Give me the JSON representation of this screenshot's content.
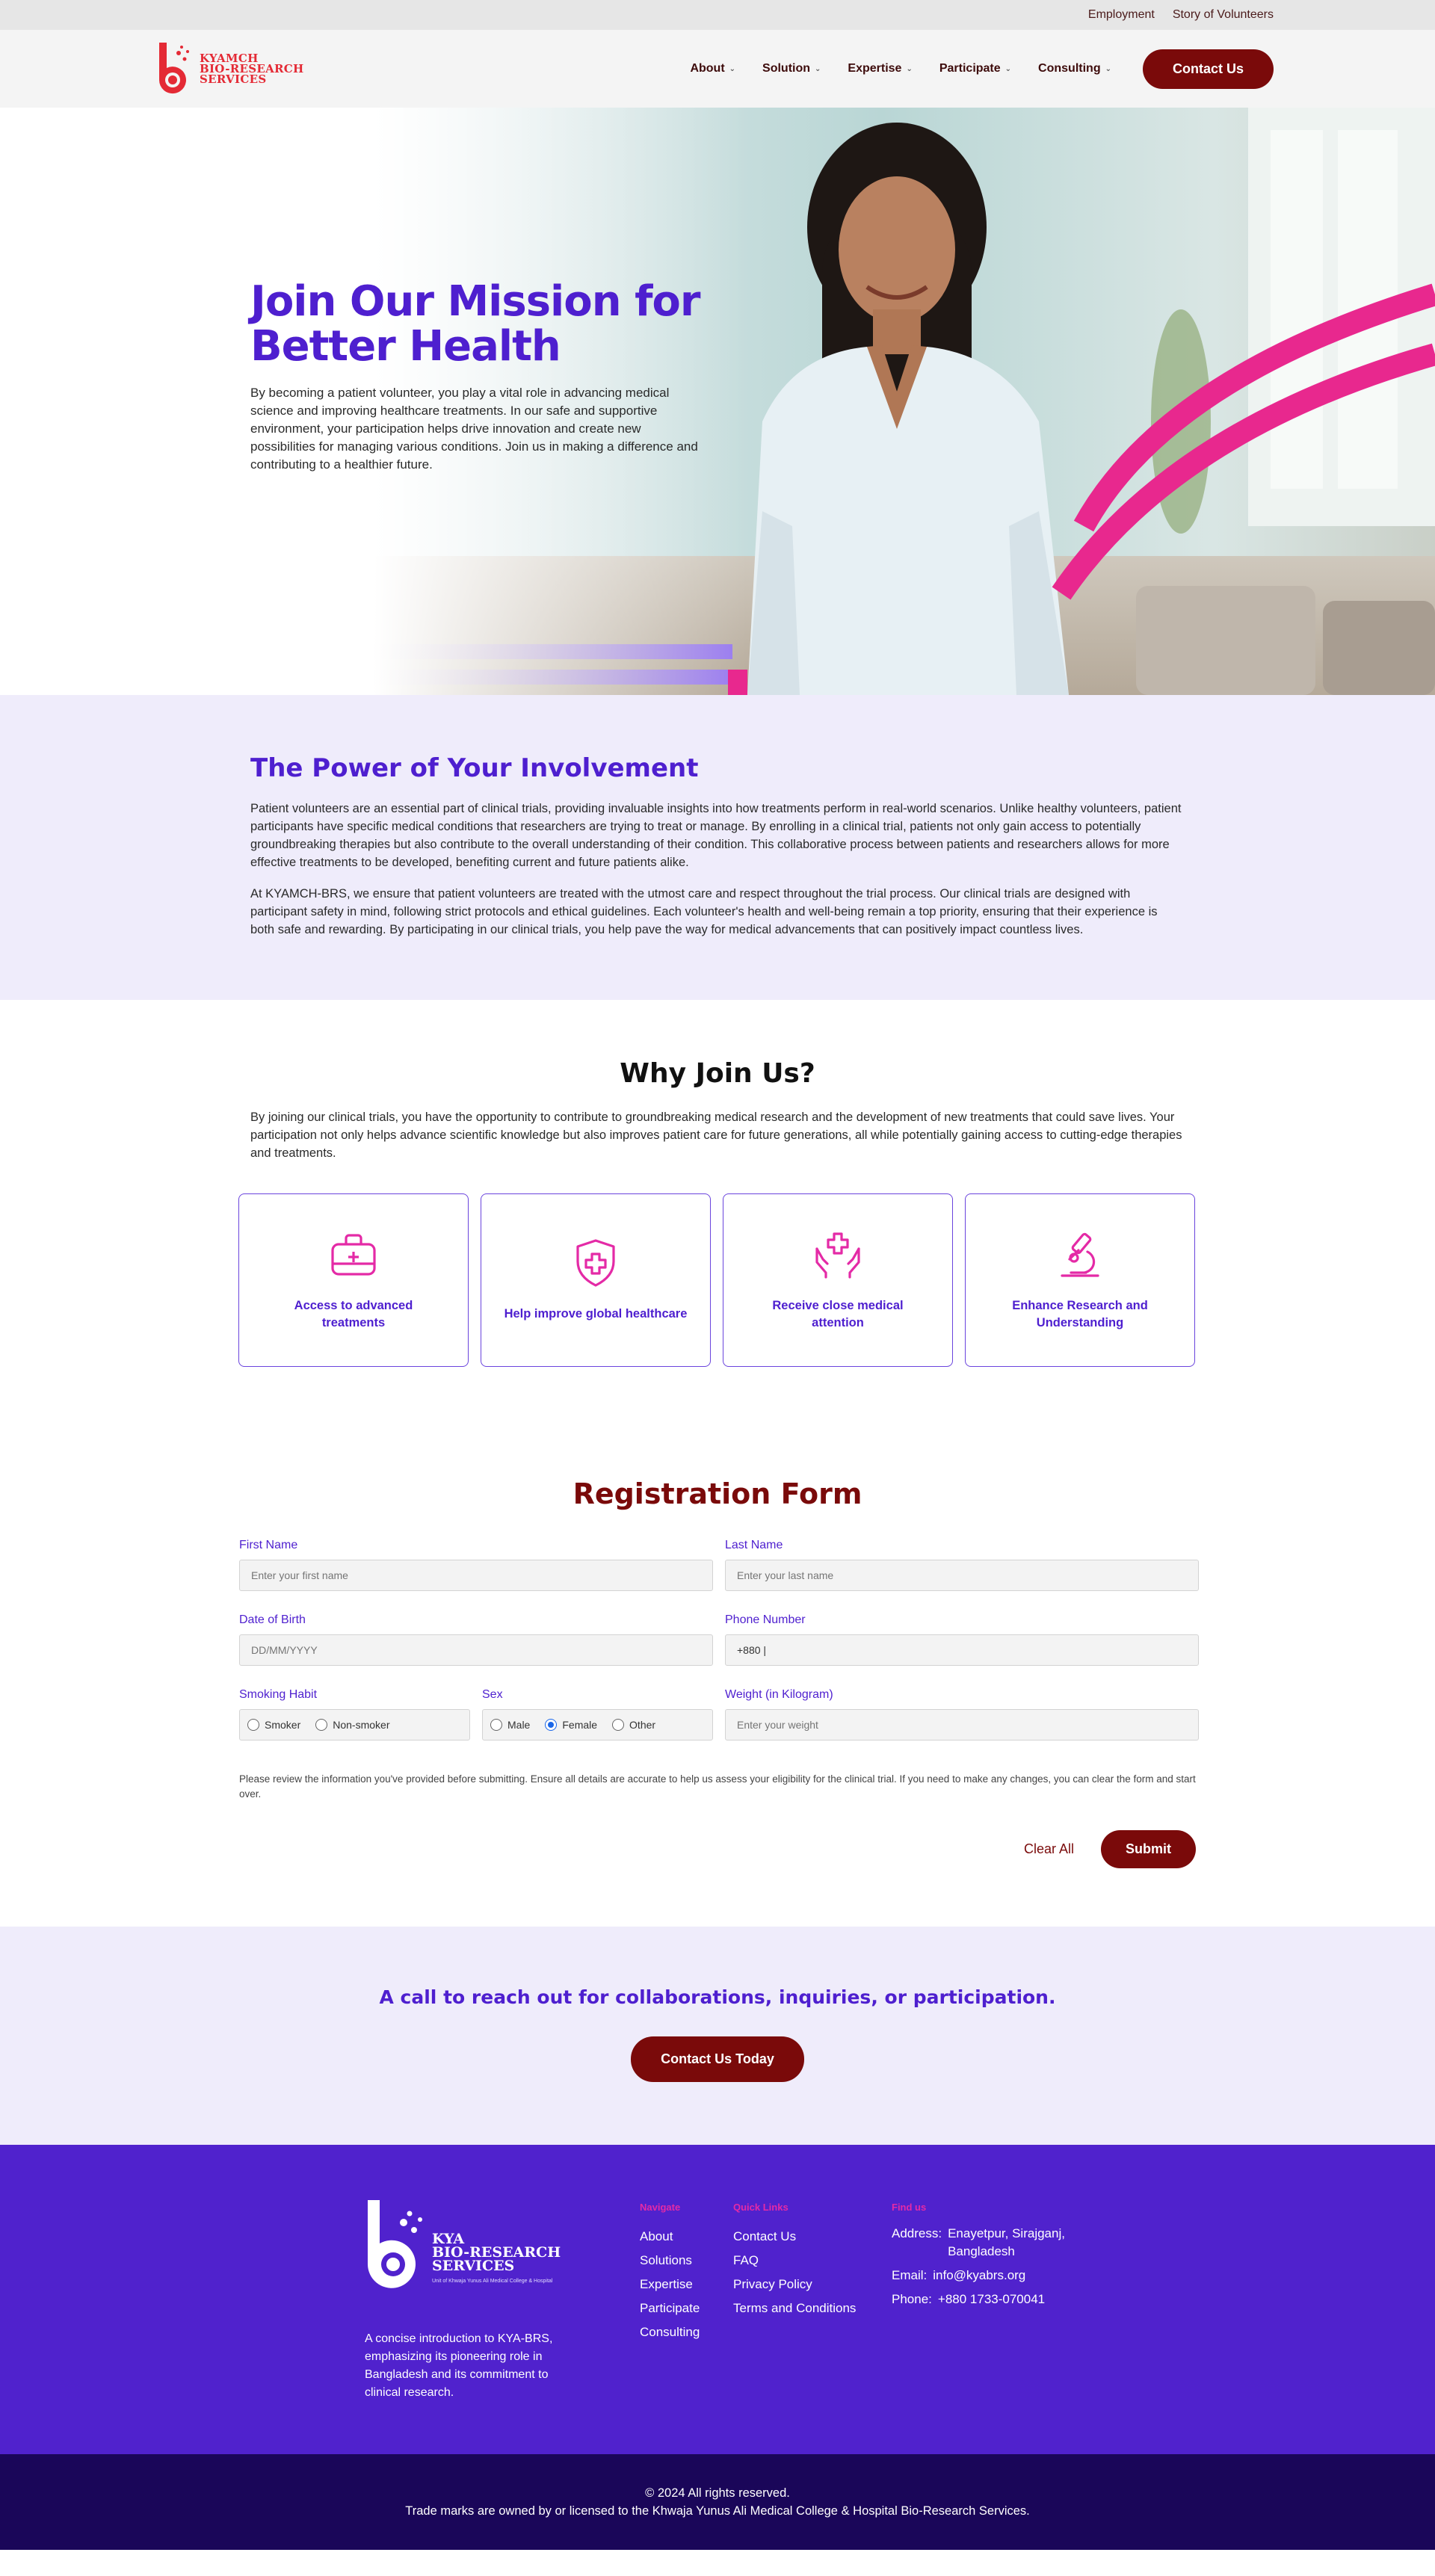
{
  "topbar": {
    "links": [
      "Employment",
      "Story of Volunteers"
    ]
  },
  "header": {
    "logo_lines": [
      "KYAMCH",
      "BIO-RESEARCH",
      "SERVICES"
    ],
    "nav": [
      "About",
      "Solution",
      "Expertise",
      "Participate",
      "Consulting"
    ],
    "contact_label": "Contact Us"
  },
  "hero": {
    "title_line1": "Join Our Mission for",
    "title_line2": "Better Health",
    "text": "By becoming a patient volunteer, you play a vital role in advancing medical science and improving healthcare treatments. In our safe and supportive environment, your participation helps drive innovation and create new possibilities for managing various conditions. Join us in making a difference and contributing to a healthier future."
  },
  "involvement": {
    "title": "The Power of Your Involvement",
    "p1": "Patient volunteers are an essential part of clinical trials, providing invaluable insights into how treatments perform in real-world scenarios. Unlike healthy volunteers, patient participants have specific medical conditions that researchers are trying to treat or manage. By enrolling in a clinical trial, patients not only gain access to potentially groundbreaking therapies but also contribute to the overall understanding of their condition. This collaborative process between patients and researchers allows for more effective treatments to be developed, benefiting current and future patients alike.",
    "p2": "At KYAMCH-BRS, we ensure that patient volunteers are treated with the utmost care and respect throughout the trial process. Our clinical trials are designed with participant safety in mind, following strict protocols and ethical guidelines. Each volunteer's health and well-being remain a top priority, ensuring that their experience is both safe and rewarding. By participating in our clinical trials, you help pave the way for medical advancements that can positively impact countless lives."
  },
  "why": {
    "title": "Why Join Us?",
    "intro": "By joining our clinical trials, you have the opportunity to contribute to groundbreaking medical research and the development of new treatments that could save lives. Your participation not only helps advance scientific knowledge but also improves patient care for future generations, all while potentially gaining access to cutting-edge therapies and treatments.",
    "cards": [
      {
        "icon": "medical-kit-icon",
        "label": "Access to advanced treatments"
      },
      {
        "icon": "shield-plus-icon",
        "label": "Help improve global healthcare"
      },
      {
        "icon": "hands-cross-icon",
        "label": "Receive close medical attention"
      },
      {
        "icon": "microscope-icon",
        "label": "Enhance Research and Understanding"
      }
    ]
  },
  "registration": {
    "title": "Registration Form",
    "first_name": {
      "label": "First Name",
      "placeholder": "Enter your first name"
    },
    "last_name": {
      "label": "Last Name",
      "placeholder": "Enter your last name"
    },
    "dob": {
      "label": "Date of Birth",
      "placeholder": "DD/MM/YYYY"
    },
    "phone": {
      "label": "Phone Number",
      "value": "+880 |"
    },
    "smoking": {
      "label": "Smoking Habit",
      "options": [
        "Smoker",
        "Non-smoker"
      ]
    },
    "sex": {
      "label": "Sex",
      "options": [
        "Male",
        "Female",
        "Other"
      ],
      "selected": "Female"
    },
    "weight": {
      "label": "Weight (in Kilogram)",
      "placeholder": "Enter your weight"
    },
    "note": "Please review the information you've provided before submitting. Ensure all details are accurate to help us assess your eligibility for the clinical trial. If you need to make any changes, you can clear the form and start over.",
    "clear_label": "Clear All",
    "submit_label": "Submit"
  },
  "cta": {
    "title": "A call to reach out for collaborations, inquiries, or participation.",
    "button": "Contact Us Today"
  },
  "footer": {
    "logo_lines": [
      "KYA",
      "BIO-RESEARCH",
      "SERVICES"
    ],
    "logo_sub": "Unit of Khwaja Yunus Ali Medical College & Hospital",
    "description": "A concise introduction to KYA-BRS, emphasizing its pioneering role in Bangladesh and its commitment to clinical research.",
    "navigate": {
      "title": "Navigate",
      "links": [
        "About",
        "Solutions",
        "Expertise",
        "Participate",
        "Consulting"
      ]
    },
    "quick": {
      "title": "Quick Links",
      "links": [
        "Contact Us",
        "FAQ",
        "Privacy Policy",
        "Terms and Conditions"
      ]
    },
    "find": {
      "title": "Find us",
      "address_label": "Address:",
      "address": "Enayetpur, Sirajganj, Bangladesh",
      "email_label": "Email:",
      "email": "info@kyabrs.org",
      "phone_label": "Phone:",
      "phone": "+880 1733-070041"
    },
    "copyright": "© 2024 All rights reserved.",
    "trademark": "Trade marks are owned by or licensed to the Khwaja Yunus Ali Medical College & Hospital Bio-Research Services."
  },
  "colors": {
    "brand_purple": "#4e1fcf",
    "maroon": "#7a0a0a",
    "pink": "#e42aa6",
    "logo_red": "#e42a35",
    "footer_bg": "#5022cd"
  }
}
